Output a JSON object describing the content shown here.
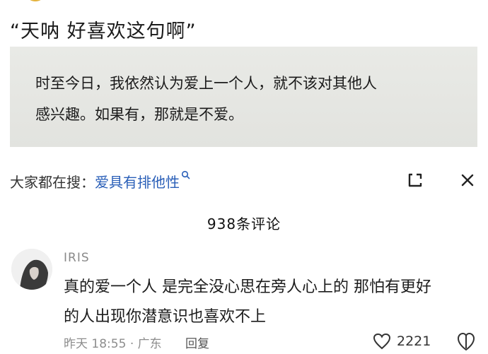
{
  "post": {
    "title": "“天呐 好喜欢这句啊”",
    "quote_lines": [
      "时至今日，我依然认为爱上一个人，就不该对其他人",
      "感兴趣。如果有，那就是不爱。"
    ]
  },
  "search_suggestion": {
    "prefix": "大家都在搜：",
    "term": "爱具有排他性"
  },
  "comments": {
    "count_label": "938条评论",
    "items": [
      {
        "username": "IRIS",
        "lines": [
          "真的爱一个人 是完全没心思在旁人心上的 那怕有更好",
          "的人出现你潜意识也喜欢不上"
        ],
        "time": "昨天 18:55",
        "location": "· 广东",
        "reply_label": "回复",
        "likes": "2221"
      }
    ]
  },
  "colors": {
    "link_blue": "#2a5fb8",
    "meta_gray": "#8d8d8d",
    "quote_bg": "#e6e7e3"
  },
  "icons": [
    "search-icon",
    "expand-icon",
    "close-icon",
    "heart-icon",
    "emoji-icon"
  ]
}
